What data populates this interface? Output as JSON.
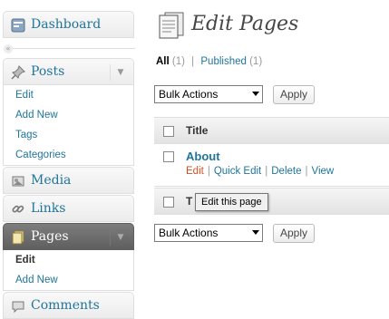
{
  "sidebar": {
    "dashboard": {
      "label": "Dashboard",
      "icon": "dashboard-icon"
    },
    "posts": {
      "label": "Posts",
      "icon": "pin-icon",
      "items": [
        {
          "label": "Edit"
        },
        {
          "label": "Add New"
        },
        {
          "label": "Tags"
        },
        {
          "label": "Categories"
        }
      ]
    },
    "media": {
      "label": "Media",
      "icon": "media-icon"
    },
    "links": {
      "label": "Links",
      "icon": "link-icon"
    },
    "pages": {
      "label": "Pages",
      "icon": "pages-icon",
      "items": [
        {
          "label": "Edit"
        },
        {
          "label": "Add New"
        }
      ]
    },
    "comments": {
      "label": "Comments",
      "icon": "comments-icon"
    }
  },
  "header": {
    "title": "Edit Pages"
  },
  "filters": {
    "all": {
      "label": "All",
      "count": "(1)"
    },
    "published": {
      "label": "Published",
      "count": "(1)"
    },
    "separator": "|"
  },
  "bulk": {
    "selected": "Bulk Actions",
    "apply_label": "Apply"
  },
  "table": {
    "column_title": "Title",
    "rows": [
      {
        "title": "About",
        "actions": [
          {
            "label": "Edit"
          },
          {
            "label": "Quick Edit"
          },
          {
            "label": "Delete"
          },
          {
            "label": "View"
          }
        ]
      }
    ],
    "footer_visible_text": "T"
  },
  "tooltip": "Edit this page",
  "colors": {
    "link": "#21759b",
    "active_menu": "#6d6d6d",
    "edit_action": "#d54e21"
  }
}
